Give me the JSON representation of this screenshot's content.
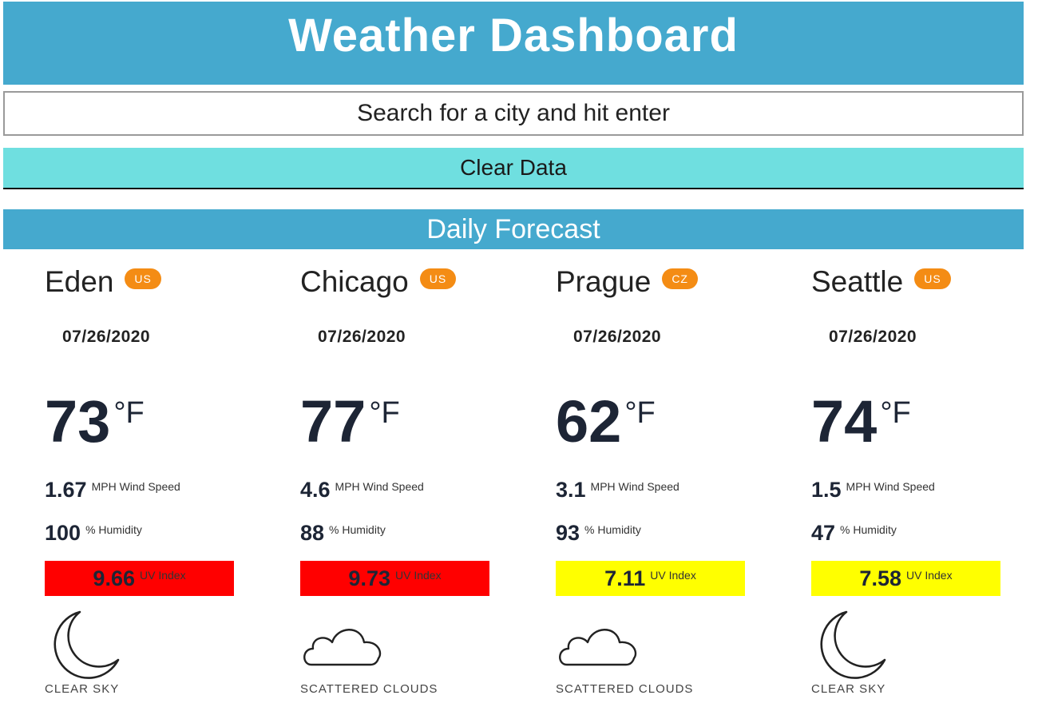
{
  "header": {
    "title": "Weather Dashboard"
  },
  "search": {
    "placeholder": "Search for a city and hit enter"
  },
  "clear_button": {
    "label": "Clear Data"
  },
  "forecast": {
    "title": "Daily Forecast",
    "labels": {
      "wind": "MPH Wind Speed",
      "humidity": "% Humidity",
      "uv": "UV Index",
      "unit": "°F"
    },
    "cities": [
      {
        "name": "Eden",
        "country": "US",
        "date": "07/26/2020",
        "temp": "73",
        "wind": "1.67",
        "humidity": "100",
        "uv": "9.66",
        "uv_color": "#ff0000",
        "icon": "moon-icon",
        "description": "CLEAR SKY"
      },
      {
        "name": "Chicago",
        "country": "US",
        "date": "07/26/2020",
        "temp": "77",
        "wind": "4.6",
        "humidity": "88",
        "uv": "9.73",
        "uv_color": "#ff0000",
        "icon": "cloud-icon",
        "description": "SCATTERED CLOUDS"
      },
      {
        "name": "Prague",
        "country": "CZ",
        "date": "07/26/2020",
        "temp": "62",
        "wind": "3.1",
        "humidity": "93",
        "uv": "7.11",
        "uv_color": "#ffff00",
        "icon": "cloud-icon",
        "description": "SCATTERED CLOUDS"
      },
      {
        "name": "Seattle",
        "country": "US",
        "date": "07/26/2020",
        "temp": "74",
        "wind": "1.5",
        "humidity": "47",
        "uv": "7.58",
        "uv_color": "#ffff00",
        "icon": "moon-icon",
        "description": "CLEAR SKY"
      }
    ]
  },
  "colors": {
    "header_bg": "#45a9ce",
    "clear_bg": "#6fdfe0",
    "badge": "#f48c14"
  }
}
